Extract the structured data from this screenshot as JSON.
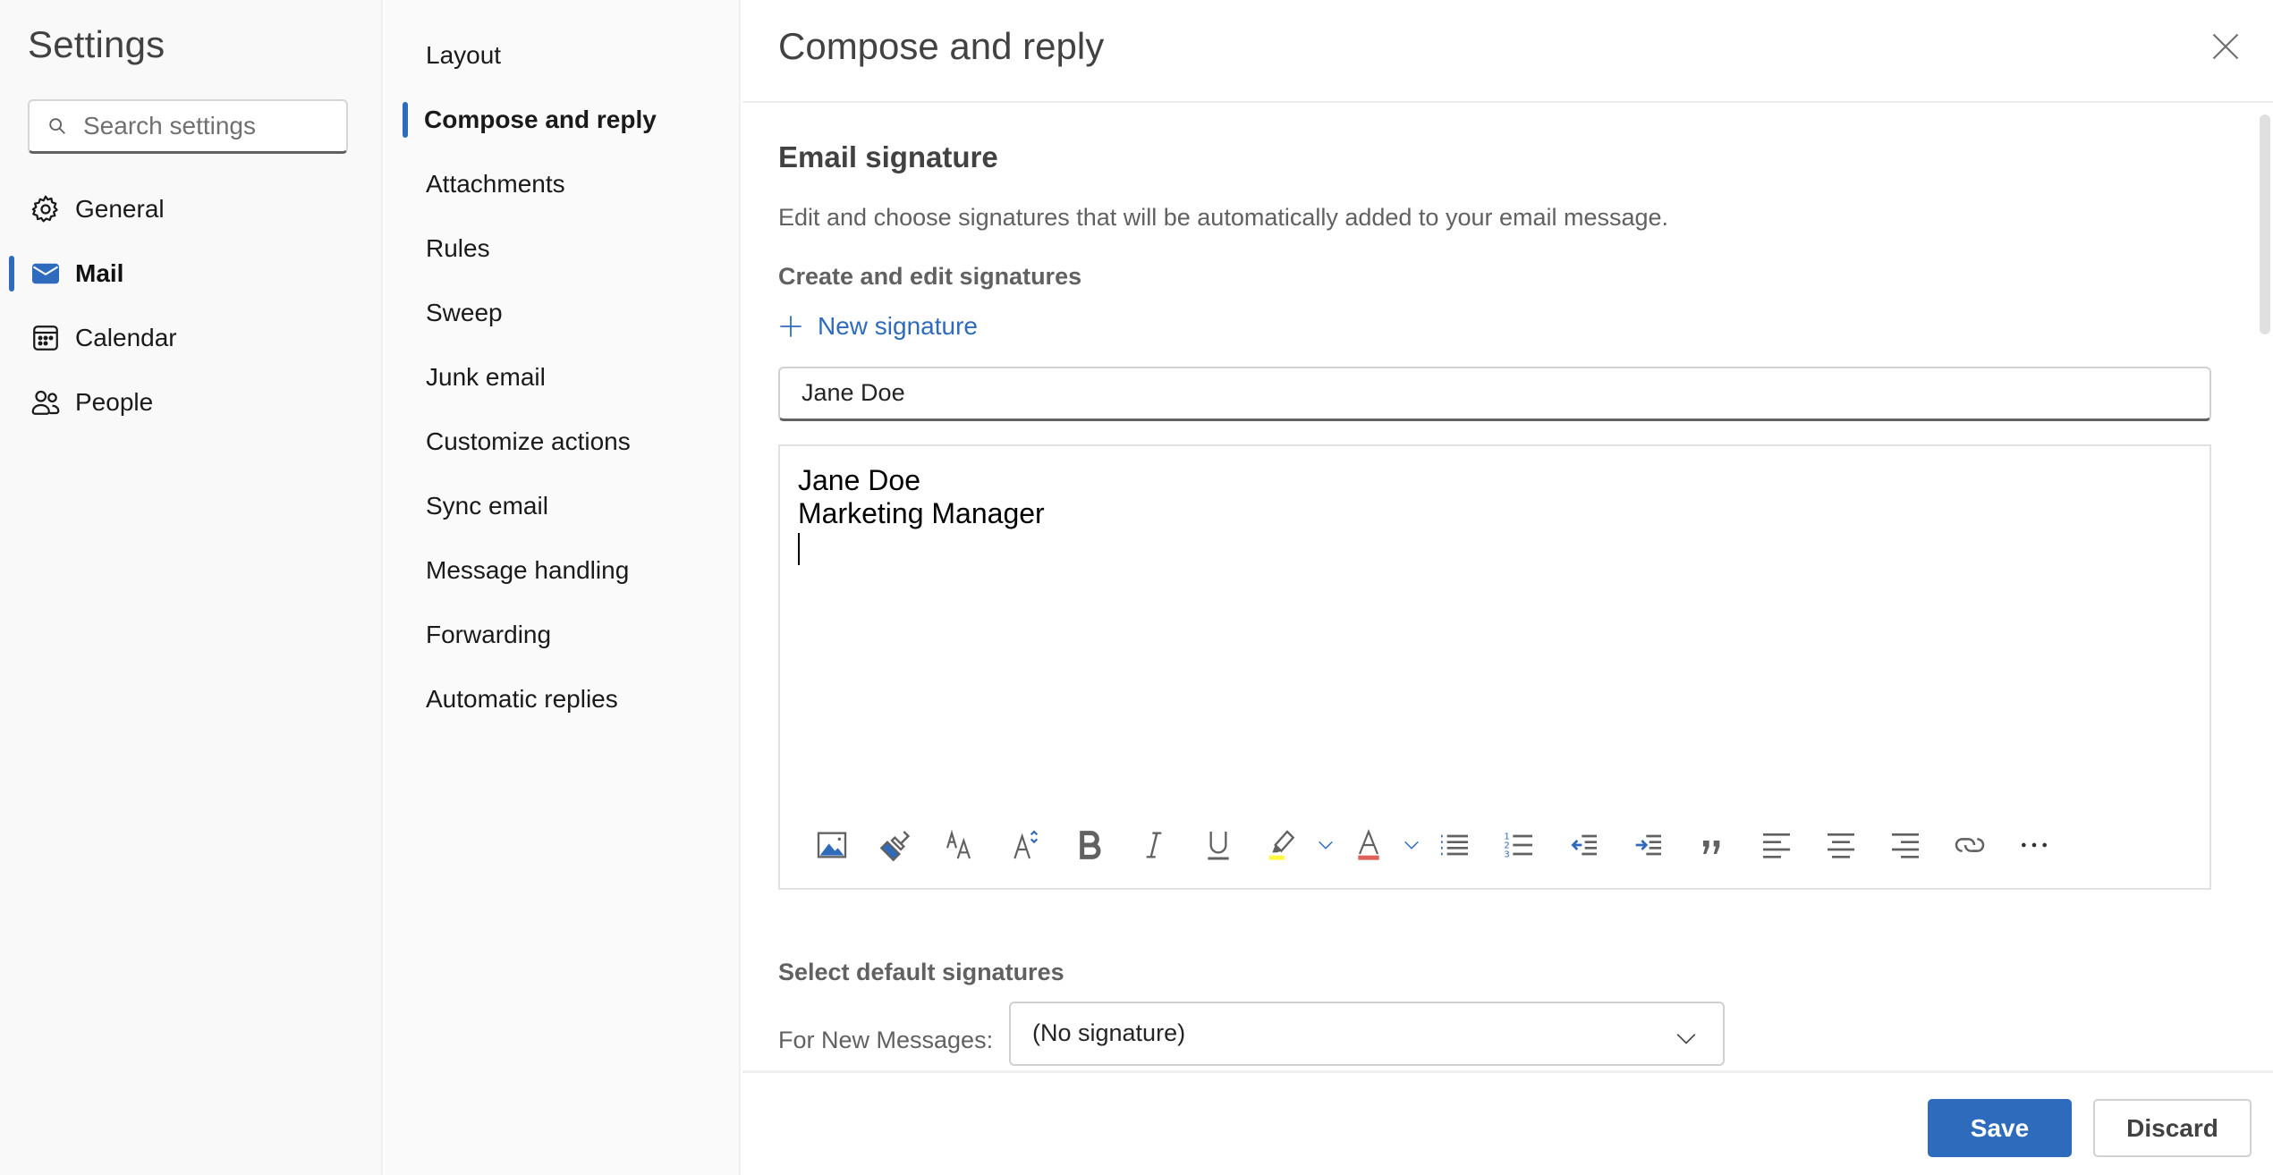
{
  "sidebar": {
    "title": "Settings",
    "search": {
      "placeholder": "Search settings",
      "value": ""
    },
    "items": [
      {
        "label": "General",
        "icon": "gear-icon",
        "active": false
      },
      {
        "label": "Mail",
        "icon": "mail-icon",
        "active": true
      },
      {
        "label": "Calendar",
        "icon": "calendar-icon",
        "active": false
      },
      {
        "label": "People",
        "icon": "people-icon",
        "active": false
      }
    ]
  },
  "nav": {
    "items": [
      {
        "label": "Layout",
        "active": false
      },
      {
        "label": "Compose and reply",
        "active": true
      },
      {
        "label": "Attachments",
        "active": false
      },
      {
        "label": "Rules",
        "active": false
      },
      {
        "label": "Sweep",
        "active": false
      },
      {
        "label": "Junk email",
        "active": false
      },
      {
        "label": "Customize actions",
        "active": false
      },
      {
        "label": "Sync email",
        "active": false
      },
      {
        "label": "Message handling",
        "active": false
      },
      {
        "label": "Forwarding",
        "active": false
      },
      {
        "label": "Automatic replies",
        "active": false
      }
    ]
  },
  "content": {
    "title": "Compose and reply",
    "close_icon": "close-icon",
    "email_signature": {
      "title": "Email signature",
      "description": "Edit and choose signatures that will be automatically added to your email message.",
      "create_edit_label": "Create and edit signatures",
      "new_signature_label": "New signature",
      "signature_name": "Jane Doe",
      "editor_lines": [
        "Jane Doe",
        "Marketing Manager"
      ],
      "toolbar": [
        {
          "name": "insert-picture",
          "icon": "picture-icon"
        },
        {
          "name": "format-painter",
          "icon": "paintbrush-icon"
        },
        {
          "name": "font",
          "icon": "font-icon"
        },
        {
          "name": "font-size",
          "icon": "font-size-icon"
        },
        {
          "name": "bold",
          "icon": "bold-icon"
        },
        {
          "name": "italic",
          "icon": "italic-icon"
        },
        {
          "name": "underline",
          "icon": "underline-icon"
        },
        {
          "name": "highlight",
          "icon": "highlighter-icon",
          "dropdown": true
        },
        {
          "name": "font-color",
          "icon": "font-color-icon",
          "dropdown": true
        },
        {
          "name": "bullets",
          "icon": "bullet-list-icon"
        },
        {
          "name": "numbering",
          "icon": "numbered-list-icon"
        },
        {
          "name": "decrease-indent",
          "icon": "decrease-indent-icon"
        },
        {
          "name": "increase-indent",
          "icon": "increase-indent-icon"
        },
        {
          "name": "quote",
          "icon": "quote-icon"
        },
        {
          "name": "align-left",
          "icon": "align-left-icon"
        },
        {
          "name": "align-center",
          "icon": "align-center-icon"
        },
        {
          "name": "align-right",
          "icon": "align-right-icon"
        },
        {
          "name": "link",
          "icon": "link-icon"
        },
        {
          "name": "more-options",
          "icon": "more-icon"
        }
      ]
    },
    "default_signatures": {
      "title": "Select default signatures",
      "for_new_messages_label": "For New Messages:",
      "for_new_messages_value": "(No signature)"
    }
  },
  "footer": {
    "save_label": "Save",
    "discard_label": "Discard"
  },
  "colors": {
    "accent": "#2f6bbc",
    "highlight_yellow": "#fff93f",
    "font_color_red": "#dc625a",
    "sidebar_bg": "#f9f9f9"
  }
}
